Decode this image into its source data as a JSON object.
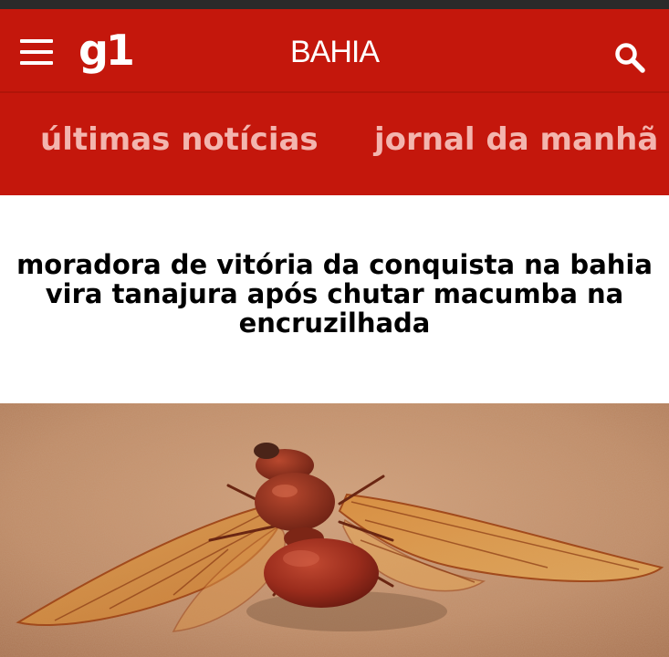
{
  "header": {
    "logo": "g1",
    "region": "BAHIA",
    "menu_icon": "hamburger-menu-icon",
    "search_icon": "search-icon",
    "background": "#c4170c"
  },
  "nav": {
    "items": [
      {
        "label": "últimas notícias"
      },
      {
        "label": "jornal da manhã"
      }
    ],
    "text_color": "#f3b5ae"
  },
  "article": {
    "headline": "moradora de vitória da conquista na bahia vira tanajura após chutar macumba na encruzilhada",
    "image_subject": "winged ant (tanajura) on sandy ground"
  }
}
